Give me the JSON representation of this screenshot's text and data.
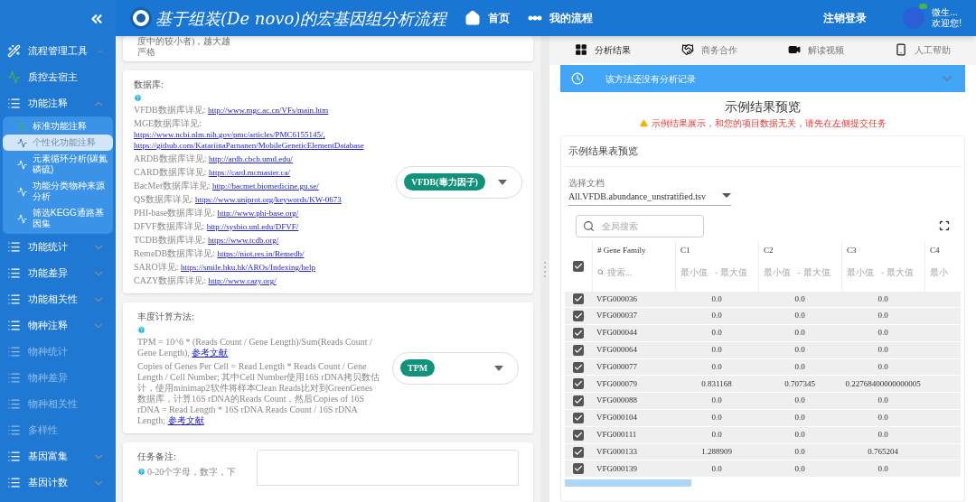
{
  "sidebar": {
    "items": [
      {
        "label": "流程管理工具",
        "kind": "tool",
        "expanded": false,
        "disabled": false
      },
      {
        "label": "质控去宿主",
        "kind": "qc",
        "disabled": false
      },
      {
        "label": "功能注释",
        "kind": "group",
        "expanded": true,
        "disabled": false,
        "children": [
          {
            "label": "标准功能注释",
            "kind": "standard",
            "selected": false
          },
          {
            "label": "个性化功能注释",
            "kind": "custom",
            "selected": true
          },
          {
            "label": "元素循环分析(碳氮磷硫)",
            "kind": "custom",
            "selected": false
          },
          {
            "label": "功能分类物种来源分析",
            "kind": "custom",
            "selected": false
          },
          {
            "label": "筛选KEGG通路基因集",
            "kind": "custom",
            "selected": false
          }
        ]
      },
      {
        "label": "功能统计",
        "kind": "group",
        "expanded": false,
        "disabled": false
      },
      {
        "label": "功能差异",
        "kind": "group",
        "expanded": false,
        "disabled": false
      },
      {
        "label": "功能相关性",
        "kind": "group",
        "expanded": false,
        "disabled": false
      },
      {
        "label": "物种注释",
        "kind": "group",
        "expanded": false,
        "disabled": false
      },
      {
        "label": "物种统计",
        "kind": "group",
        "disabled": true
      },
      {
        "label": "物种差异",
        "kind": "group",
        "disabled": true
      },
      {
        "label": "物种相关性",
        "kind": "group",
        "disabled": true
      },
      {
        "label": "多样性",
        "kind": "group",
        "disabled": true
      },
      {
        "label": "基因富集",
        "kind": "group",
        "expanded": false,
        "disabled": false
      },
      {
        "label": "基因计数",
        "kind": "group",
        "expanded": false,
        "disabled": false
      }
    ]
  },
  "header": {
    "title": "基于组装(De novo)的宏基因组分析流程",
    "nav": [
      {
        "label": "首页",
        "kind": "home"
      },
      {
        "label": "我的流程",
        "kind": "flow"
      }
    ],
    "logout": "注销登录",
    "user_name": "微生...",
    "greeting": "欢迎您!"
  },
  "form": {
    "top_note": "度中的较小者)，越大越严格",
    "database": {
      "label": "数据库:",
      "entries": [
        {
          "label": "VFDB数据库详见: ",
          "links": [
            "http://www.mgc.ac.cn/VFs/main.htm"
          ]
        },
        {
          "label": "MGE数据库详见: ",
          "links": [
            "https://www.ncbi.nlm.nih.gov/pmc/articles/PMC6155145/,",
            "https://github.com/KatariinaParnanen/MobileGeneticElementDatabase"
          ]
        },
        {
          "label": "ARDB数据库详见: ",
          "links": [
            "http://ardb.cbcb.umd.edu/"
          ]
        },
        {
          "label": "CARD数据库详见: ",
          "links": [
            "https://card.mcmaster.ca/"
          ]
        },
        {
          "label": "BacMet数据库详见: ",
          "links": [
            "http://bacmet.biomedicine.gu.se/"
          ]
        },
        {
          "label": "QS数据库详见: ",
          "links": [
            "https://www.uniprot.org/keywords/KW-0673"
          ]
        },
        {
          "label": "PHI-base数据库详见: ",
          "links": [
            "http://www.phi-base.org/"
          ]
        },
        {
          "label": "DFVF数据库详见: ",
          "links": [
            "http://sysbio.unl.edu/DFVF/"
          ]
        },
        {
          "label": "TCDB数据库详见: ",
          "links": [
            "https://www.tcdb.org/"
          ]
        },
        {
          "label": "RemeDB数据库详见: ",
          "links": [
            "https://niot.res.in/Remedb/"
          ]
        },
        {
          "label": "SARO详见: ",
          "links": [
            "https://smile.hku.hk/AROs/Indexing/help"
          ]
        },
        {
          "label": "CAZY数据库详见: ",
          "links": [
            "http://www.cazy.org/"
          ]
        }
      ],
      "value": "VFDB(毒力因子)"
    },
    "abundance": {
      "label": "丰度计算方法:",
      "paragraphs": [
        {
          "text": "TPM = 10^6 * (Reads Count / Gene Length)/Sum(Reads Count / Gene Length), ",
          "link": "参考文献"
        },
        {
          "text": "Copies of Genes Per Cell = Read Length * Reads Count / Gene Length / Cell Number; 其中Cell Number使用16S rDNA拷贝数估计，使用minimap2软件将样本Clean Reads比对到GreenGenes数据库，计算16S rDNA的Reads Count，然后Copies of 16S rDNA = Read Length * 16S rDNA Reads Count / 16S rDNA Length; ",
          "link": "参考文献"
        }
      ],
      "value": "TPM"
    },
    "note": {
      "label": "任务备注:",
      "hint": "0-20个字母，数字，下"
    }
  },
  "results": {
    "tabs": [
      {
        "label": "分析结果",
        "kind": "grid",
        "selected": true
      },
      {
        "label": "商务合作",
        "kind": "handshake",
        "selected": false
      },
      {
        "label": "解读视频",
        "kind": "video",
        "selected": false
      },
      {
        "label": "人工帮助",
        "kind": "phone",
        "selected": false
      }
    ],
    "history": "该方法还没有分析记录",
    "title": "示例结果预览",
    "warning": "示例结果展示，和您的项目数据无关，请先在左侧提交任务",
    "table_card": {
      "title": "示例结果表预览",
      "file_label": "选择文档",
      "file": "All.VFDB.abundance_unstratified.tsv",
      "search_placeholder": "全局搜索",
      "all_checked": true,
      "columns": [
        {
          "name": "# Gene Family",
          "kind": "text",
          "placeholder": "搜索..."
        },
        {
          "name": "C1",
          "kind": "range",
          "min": "最小值",
          "max": "- 最大值"
        },
        {
          "name": "C2",
          "kind": "range",
          "min": "最小值",
          "max": "- 最大值"
        },
        {
          "name": "C3",
          "kind": "range",
          "min": "最小值",
          "max": "- 最大值"
        },
        {
          "name": "C4",
          "kind": "range",
          "min": "最小"
        }
      ],
      "rows": [
        {
          "id": "VFG000036",
          "checked": true,
          "values": [
            "0.0",
            "0.0",
            "0.0"
          ]
        },
        {
          "id": "VFG000037",
          "checked": true,
          "values": [
            "0.0",
            "0.0",
            "0.0"
          ]
        },
        {
          "id": "VFG000044",
          "checked": true,
          "values": [
            "0.0",
            "0.0",
            "0.0"
          ]
        },
        {
          "id": "VFG000064",
          "checked": true,
          "values": [
            "0.0",
            "0.0",
            "0.0"
          ]
        },
        {
          "id": "VFG000077",
          "checked": true,
          "values": [
            "0.0",
            "0.0",
            "0.0"
          ]
        },
        {
          "id": "VFG000079",
          "checked": true,
          "values": [
            "0.831168",
            "0.707345",
            "0.22768400000000005"
          ]
        },
        {
          "id": "VFG000088",
          "checked": true,
          "values": [
            "0.0",
            "0.0",
            "0.0"
          ]
        },
        {
          "id": "VFG000104",
          "checked": true,
          "values": [
            "0.0",
            "0.0",
            "0.0"
          ]
        },
        {
          "id": "VFG000111",
          "checked": true,
          "values": [
            "0.0",
            "0.0",
            "0.0"
          ]
        },
        {
          "id": "VFG000133",
          "checked": true,
          "values": [
            "1.288909",
            "0.0",
            "0.765204"
          ]
        },
        {
          "id": "VFG000139",
          "checked": true,
          "values": [
            "0.0",
            "0.0",
            "0.0"
          ]
        }
      ]
    }
  }
}
